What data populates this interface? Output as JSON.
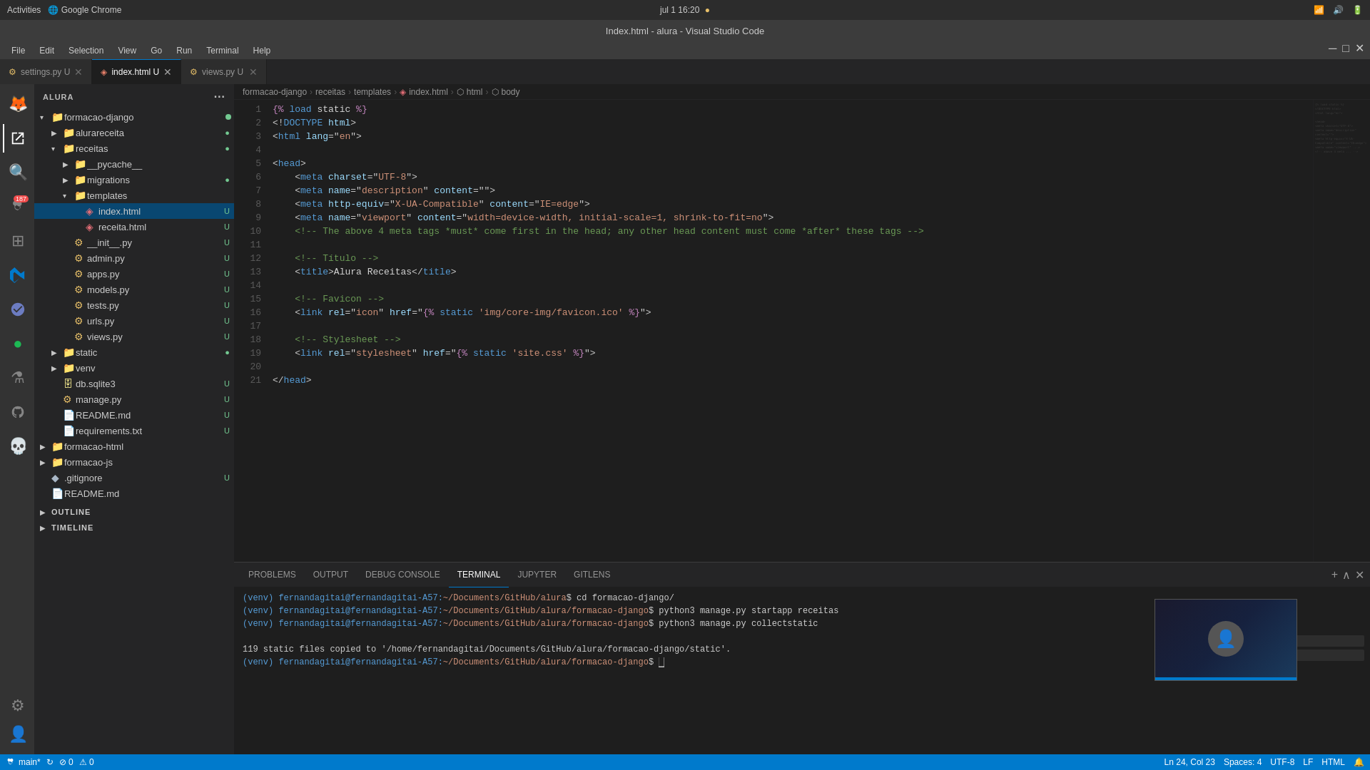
{
  "system_bar": {
    "left": "Activities",
    "browser": "Google Chrome",
    "time": "jul 1  16:20",
    "recording_dot": "●"
  },
  "title_bar": {
    "title": "Index.html - alura - Visual Studio Code"
  },
  "menu": {
    "items": [
      "File",
      "Edit",
      "Selection",
      "View",
      "Go",
      "Run",
      "Terminal",
      "Help"
    ]
  },
  "tabs": [
    {
      "name": "settings.py",
      "status": "U",
      "active": false
    },
    {
      "name": "index.html",
      "status": "U",
      "active": true
    },
    {
      "name": "views.py",
      "status": "U",
      "active": false
    }
  ],
  "breadcrumb": {
    "parts": [
      "formacao-django",
      "receitas",
      "templates",
      "index.html",
      "html",
      "body"
    ]
  },
  "sidebar": {
    "header": "ALURA",
    "tree": [
      {
        "level": 0,
        "type": "folder",
        "name": "formacao-django",
        "expanded": true,
        "status": ""
      },
      {
        "level": 1,
        "type": "folder",
        "name": "alurareceita",
        "expanded": false,
        "status": "dot-green"
      },
      {
        "level": 1,
        "type": "folder",
        "name": "receitas",
        "expanded": true,
        "status": "dot-green"
      },
      {
        "level": 2,
        "type": "folder",
        "name": "__pycache__",
        "expanded": false,
        "status": ""
      },
      {
        "level": 2,
        "type": "folder",
        "name": "migrations",
        "expanded": false,
        "status": "dot-green"
      },
      {
        "level": 2,
        "type": "folder",
        "name": "templates",
        "expanded": true,
        "status": ""
      },
      {
        "level": 3,
        "type": "file",
        "name": "index.html",
        "status": "U",
        "selected": true
      },
      {
        "level": 3,
        "type": "file",
        "name": "receita.html",
        "status": "U"
      },
      {
        "level": 2,
        "type": "file",
        "name": "__init__.py",
        "status": "U"
      },
      {
        "level": 2,
        "type": "file",
        "name": "admin.py",
        "status": "U"
      },
      {
        "level": 2,
        "type": "file",
        "name": "apps.py",
        "status": "U"
      },
      {
        "level": 2,
        "type": "file",
        "name": "models.py",
        "status": "U"
      },
      {
        "level": 2,
        "type": "file",
        "name": "tests.py",
        "status": "U"
      },
      {
        "level": 2,
        "type": "file",
        "name": "urls.py",
        "status": "U"
      },
      {
        "level": 2,
        "type": "file",
        "name": "views.py",
        "status": "U"
      },
      {
        "level": 1,
        "type": "folder",
        "name": "static",
        "expanded": false,
        "status": "dot-green"
      },
      {
        "level": 1,
        "type": "folder",
        "name": "venv",
        "expanded": false,
        "status": ""
      },
      {
        "level": 1,
        "type": "file",
        "name": "db.sqlite3",
        "status": "U"
      },
      {
        "level": 1,
        "type": "file",
        "name": "manage.py",
        "status": "U"
      },
      {
        "level": 1,
        "type": "file",
        "name": "README.md",
        "status": "U"
      },
      {
        "level": 1,
        "type": "file",
        "name": "requirements.txt",
        "status": "U"
      },
      {
        "level": 0,
        "type": "folder",
        "name": "formacao-html",
        "expanded": false,
        "status": ""
      },
      {
        "level": 0,
        "type": "folder",
        "name": "formacao-js",
        "expanded": false,
        "status": ""
      },
      {
        "level": 0,
        "type": "file",
        "name": ".gitignore",
        "status": "U"
      },
      {
        "level": 0,
        "type": "file",
        "name": "README.md",
        "status": ""
      }
    ]
  },
  "editor": {
    "lines": [
      {
        "num": 1,
        "code": "{% load static %}"
      },
      {
        "num": 2,
        "code": "<!DOCTYPE html>"
      },
      {
        "num": 3,
        "code": "<html lang=\"en\">"
      },
      {
        "num": 4,
        "code": ""
      },
      {
        "num": 5,
        "code": "<head>"
      },
      {
        "num": 6,
        "code": "    <meta charset=\"UTF-8\">"
      },
      {
        "num": 7,
        "code": "    <meta name=\"description\" content=\"\">"
      },
      {
        "num": 8,
        "code": "    <meta http-equiv=\"X-UA-Compatible\" content=\"IE=edge\">"
      },
      {
        "num": 9,
        "code": "    <meta name=\"viewport\" content=\"width=device-width, initial-scale=1, shrink-to-fit=no\">"
      },
      {
        "num": 10,
        "code": "    <!-- The above 4 meta tags *must* come first in the head; any other head content must come *after* these tags -->"
      },
      {
        "num": 11,
        "code": ""
      },
      {
        "num": 12,
        "code": "    <!-- Título -->"
      },
      {
        "num": 13,
        "code": "    <title>Alura Receitas</title>"
      },
      {
        "num": 14,
        "code": ""
      },
      {
        "num": 15,
        "code": "    <!-- Favicon -->"
      },
      {
        "num": 16,
        "code": "    <link rel=\"icon\" href=\"{% static 'img/core-img/favicon.ico' %}\">"
      },
      {
        "num": 17,
        "code": ""
      },
      {
        "num": 18,
        "code": "    <!-- Stylesheet -->"
      },
      {
        "num": 19,
        "code": "    <link rel=\"stylesheet\" href=\"{% static 'site.css' %}\">"
      },
      {
        "num": 20,
        "code": ""
      },
      {
        "num": 21,
        "code": "</head>"
      }
    ]
  },
  "panel": {
    "tabs": [
      "PROBLEMS",
      "OUTPUT",
      "DEBUG CONSOLE",
      "TERMINAL",
      "JUPYTER",
      "GITLENS"
    ],
    "active_tab": "TERMINAL",
    "terminal_lines": [
      "(venv) fernandagitai@fernandagitai-A57:~/Documents/GitHub/alura$ cd formacao-django/",
      "(venv) fernandagitai@fernandagitai-A57:~/Documents/GitHub/alura/formacao-django$ python3 manage.py startapp receitas",
      "(venv) fernandagitai@fernandagitai-A57:~/Documents/GitHub/alura/formacao-django$ python3 manage.py collectstatic",
      "",
      "119 static files copied to '/home/fernandagitai/Documents/GitHub/alura/formacao-django/static'.",
      "(venv) fernandagitai@fernandagitai-A57:~/Documents/GitHub/alura/formacao-django$ "
    ]
  },
  "status_bar": {
    "branch": "main*",
    "sync": "↻",
    "errors": "⊘ 0",
    "warnings": "⚠ 0",
    "ln": "Ln 24, Col 23",
    "spaces": "Spaces: 4",
    "encoding": "UTF-8",
    "line_ending": "LF",
    "language": "HTML"
  },
  "outline": {
    "label": "OUTLINE"
  },
  "timeline": {
    "label": "TIMELINE"
  }
}
